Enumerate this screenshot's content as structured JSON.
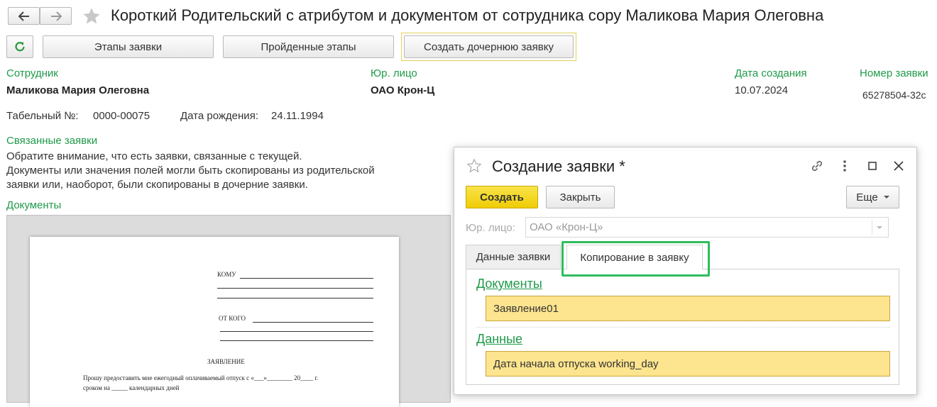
{
  "window": {
    "title": "Короткий Родительский с атрибутом и документом от сотрудника сору Маликова Мария Олеговна"
  },
  "toolbar": {
    "stages_label": "Этапы заявки",
    "passed_stages_label": "Пройденные этапы",
    "create_child_label": "Создать дочернюю заявку"
  },
  "form": {
    "employee_label": "Сотрудник",
    "employee_value": "Маликова Мария Олеговна",
    "legal_entity_label": "Юр. лицо",
    "legal_entity_value": "ОАО Крон-Ц",
    "created_date_label": "Дата создания",
    "created_date_value": "10.07.2024",
    "number_label": "Номер заявки",
    "number_value": "65278504-32c",
    "tab_number_label": "Табельный №:",
    "tab_number_value": "0000-00075",
    "birth_date_label": "Дата рождения:",
    "birth_date_value": "24.11.1994",
    "related_label": "Связанные заявки",
    "related_note_1": "Обратите внимание, что есть заявки, связанные с текущей.",
    "related_note_2": "Документы или значения полей могли быть скопированы из родительской",
    "related_note_3": "заявки или, наоборот, были скопированы в дочерние заявки.",
    "documents_label": "Документы"
  },
  "document_preview": {
    "to": "КОМУ",
    "from": "ОТ КОГО",
    "heading": "ЗАЯВЛЕНИЕ",
    "body_1": "Прошу предоставить мне ежегодный оплачиваемый отпуск с «___»________ 20____ г.",
    "body_2": "сроком на _____ календарных дней"
  },
  "dialog": {
    "title": "Создание заявки *",
    "create_label": "Создать",
    "close_label": "Закрыть",
    "more_label": "Еще",
    "legal_entity_label": "Юр. лицо:",
    "legal_entity_value": "ОАО «Крон-Ц»",
    "tabs": [
      {
        "label": "Данные заявки"
      },
      {
        "label": "Копирование в заявку"
      }
    ],
    "documents_link": "Документы",
    "document_item": "Заявление01",
    "data_link": "Данные",
    "data_item": "Дата начала отпуска working_day"
  },
  "colors": {
    "accent_green": "#1f9a4a",
    "highlight_yellow": "#fde48e",
    "primary_button": "#f5d60f",
    "tab_highlight": "#2ebd5c"
  }
}
